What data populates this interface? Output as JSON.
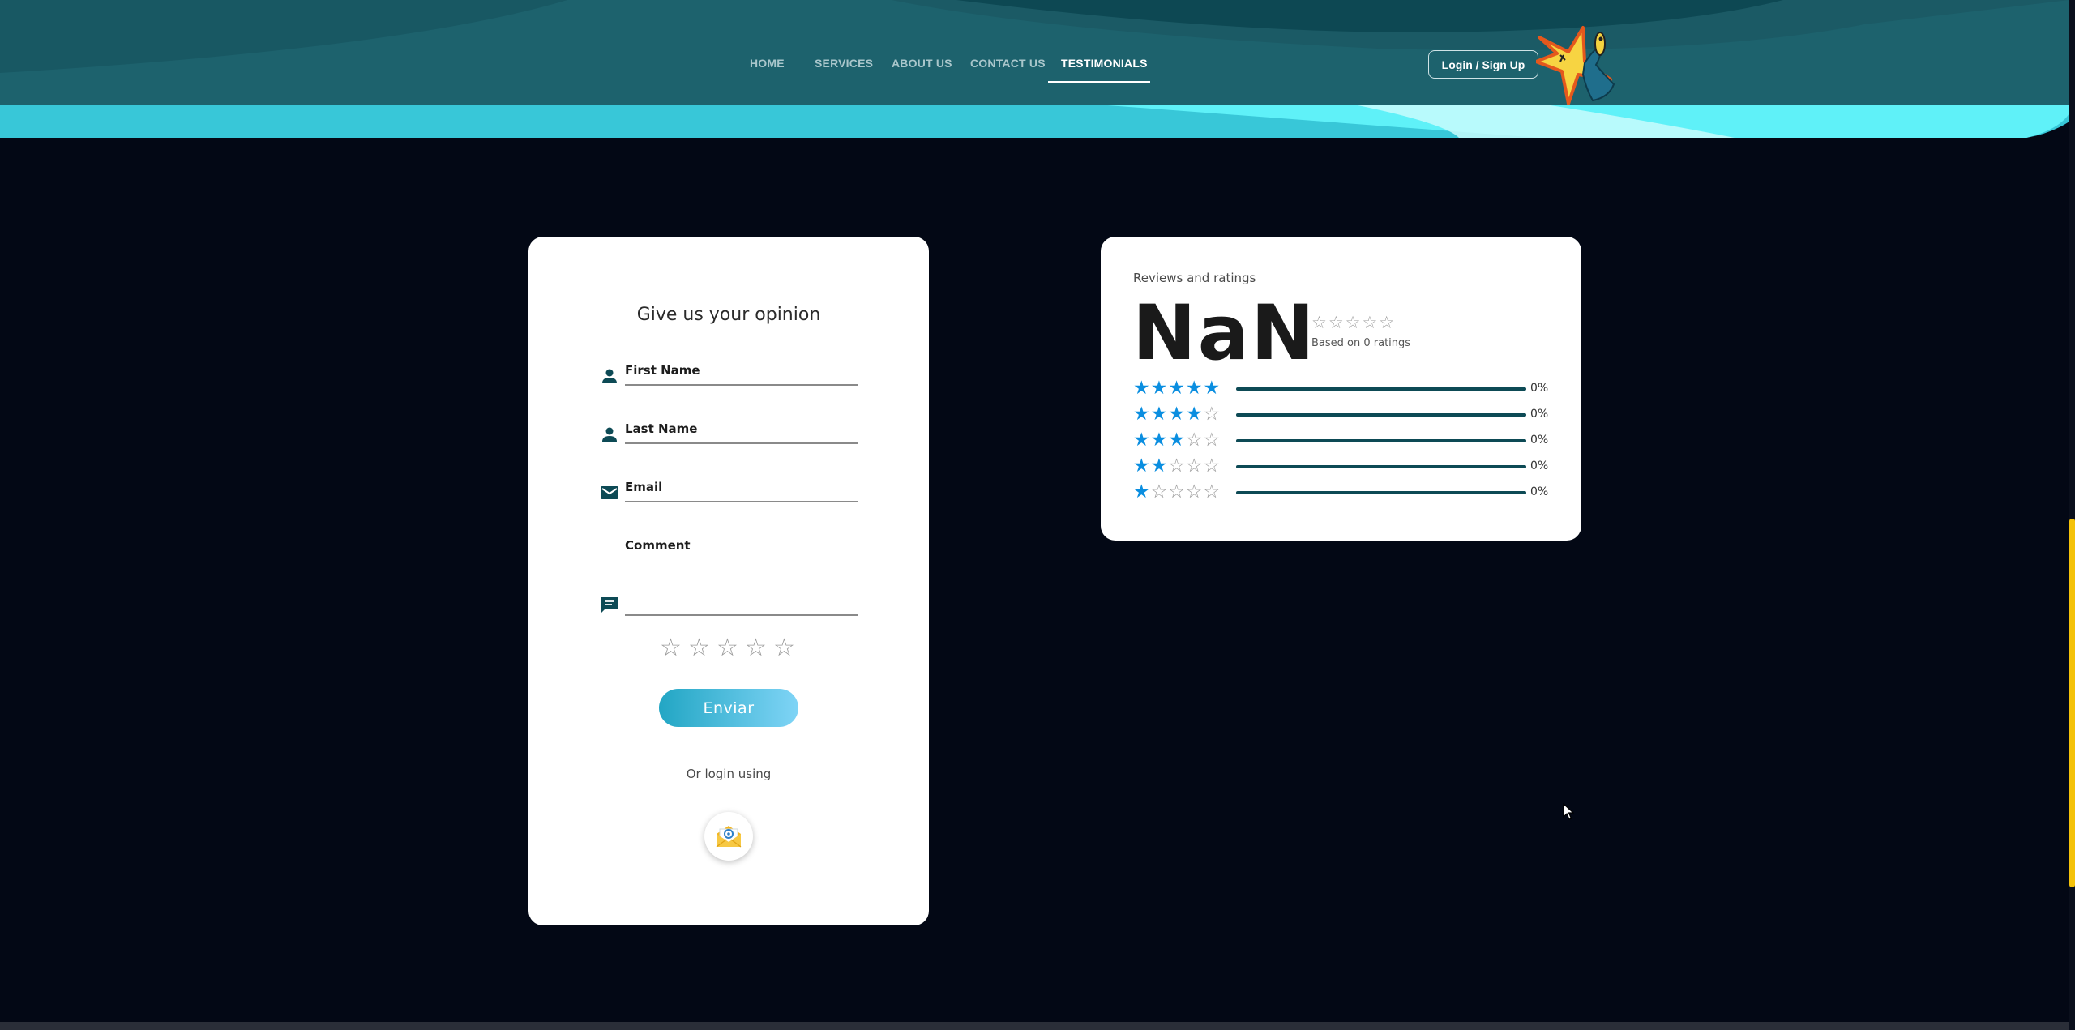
{
  "nav": {
    "items": [
      "HOME",
      "SERVICES",
      "ABOUT US",
      "CONTACT US",
      "TESTIMONIALS"
    ],
    "active": "TESTIMONIALS",
    "login_label": "Login / Sign Up"
  },
  "opinion_form": {
    "title": "Give us your opinion",
    "first_name_label": "First Name",
    "last_name_label": "Last Name",
    "email_label": "Email",
    "comment_label": "Comment",
    "rating_stars": [
      "☆",
      "☆",
      "☆",
      "☆",
      "☆"
    ],
    "rating_value": 0,
    "submit_label": "Enviar",
    "alt_login_text": "Or login using",
    "alt_login_icon": "email-icon"
  },
  "reviews": {
    "title": "Reviews and ratings",
    "average": "NaN",
    "average_stars": "☆☆☆☆☆",
    "based_on": "Based on 0 ratings",
    "rows": [
      {
        "stars": 5,
        "percent": "0%"
      },
      {
        "stars": 4,
        "percent": "0%"
      },
      {
        "stars": 3,
        "percent": "0%"
      },
      {
        "stars": 2,
        "percent": "0%"
      },
      {
        "stars": 1,
        "percent": "0%"
      }
    ]
  },
  "colors": {
    "page_bg": "#030815",
    "header_bg": "#1d5b66",
    "header_wave_light": "#5ff1f8",
    "accent_button": "#22a6c4",
    "star_filled": "#0a8ee0",
    "bar": "#0d4a55",
    "scrollbar_thumb": "#f4c20a"
  }
}
